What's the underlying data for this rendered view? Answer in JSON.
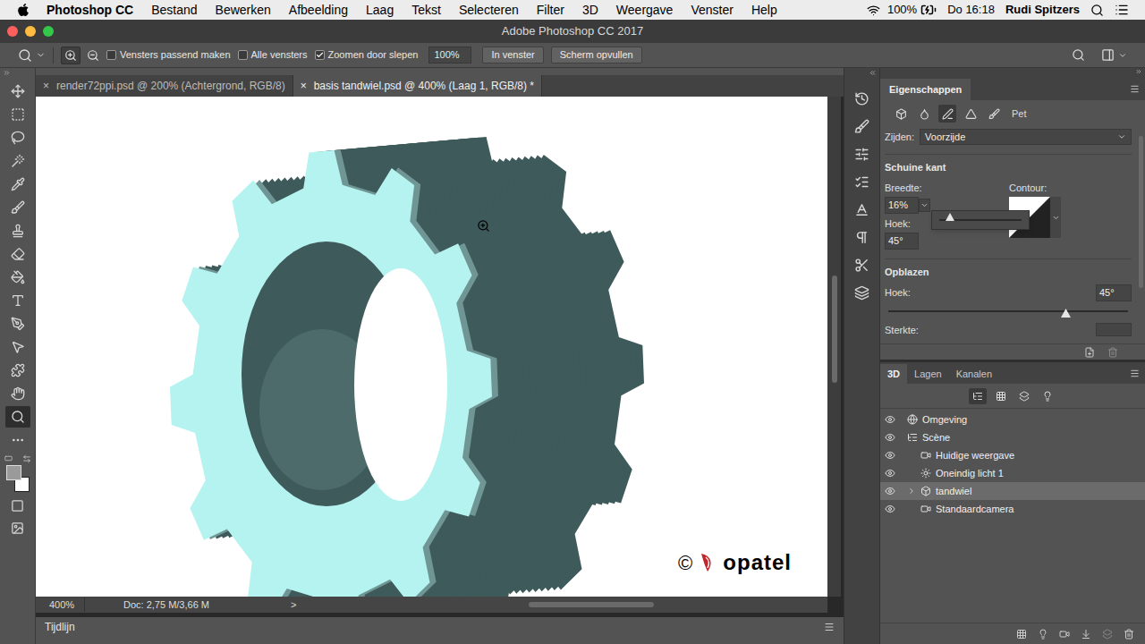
{
  "menubar": {
    "app": "Photoshop CC",
    "menus": [
      "Bestand",
      "Bewerken",
      "Afbeelding",
      "Laag",
      "Tekst",
      "Selecteren",
      "Filter",
      "3D",
      "Weergave",
      "Venster",
      "Help"
    ],
    "battery": "100%",
    "clock": "Do 16:18",
    "user": "Rudi Spitzers"
  },
  "window": {
    "title": "Adobe Photoshop CC 2017"
  },
  "options": {
    "checkboxes": [
      {
        "label": "Vensters passend maken",
        "checked": false
      },
      {
        "label": "Alle vensters",
        "checked": false
      },
      {
        "label": "Zoomen door slepen",
        "checked": true
      }
    ],
    "zoom": "100%",
    "buttons": [
      "In venster",
      "Scherm opvullen"
    ]
  },
  "tools": [
    {
      "selected": false
    },
    {
      "selected": false
    },
    {
      "selected": false
    },
    {
      "selected": false
    },
    {
      "selected": false
    },
    {
      "selected": false
    },
    {
      "selected": false
    },
    {
      "selected": false
    },
    {
      "selected": false
    },
    {
      "selected": false
    },
    {
      "selected": false
    },
    {
      "selected": false
    },
    {
      "selected": false
    },
    {
      "selected": false
    },
    {
      "selected": true
    },
    {
      "selected": false
    }
  ],
  "colors": {
    "foreground": "#9a9a9a",
    "background": "#ffffff"
  },
  "documents": [
    {
      "label": "render72ppi.psd @ 200% (Achtergrond, RGB/8)",
      "close": "×",
      "selected": false
    },
    {
      "label": "basis tandwiel.psd @ 400% (Laag 1, RGB/8) *",
      "close": "×",
      "selected": true
    }
  ],
  "canvas": {
    "watermark": {
      "symbol": "©",
      "text": "opatel"
    }
  },
  "status_bar": {
    "zoom": "400%",
    "doc": "Doc: 2,75 M/3,66 M",
    "arrow": ">"
  },
  "timeline": {
    "title": "Tijdlijn"
  },
  "properties": {
    "title": "Eigenschappen",
    "icon_tabs": [
      {
        "selected": false
      },
      {
        "selected": false
      },
      {
        "selected": true
      },
      {
        "selected": false
      },
      {
        "selected": false
      }
    ],
    "extra_label": "Pet",
    "sides_label": "Zijden:",
    "sides_value": "Voorzijde",
    "bevel": {
      "title": "Schuine kant",
      "width_label": "Breedte:",
      "width_value": "16%",
      "contour_label": "Contour:",
      "angle_label": "Hoek:",
      "angle_value": "45°",
      "popup_level": 0.13
    },
    "inflate": {
      "title": "Opblazen",
      "angle_label": "Hoek:",
      "angle_value": "45°",
      "level": 0.74,
      "strength_label": "Sterkte:"
    }
  },
  "panel3d": {
    "tabs": [
      {
        "label": "3D",
        "selected": true
      },
      {
        "label": "Lagen",
        "selected": false
      },
      {
        "label": "Kanalen",
        "selected": false
      }
    ],
    "filters": [
      {
        "selected": true
      },
      {
        "selected": false
      },
      {
        "selected": false
      },
      {
        "selected": false
      }
    ],
    "items": [
      {
        "label": "Omgeving",
        "kind": "environment",
        "depth": 0,
        "visible": true,
        "selected": false,
        "expandable": false
      },
      {
        "label": "Scène",
        "kind": "scene",
        "depth": 0,
        "visible": true,
        "selected": false,
        "expandable": false
      },
      {
        "label": "Huidige weergave",
        "kind": "camera",
        "depth": 1,
        "visible": true,
        "selected": false,
        "expandable": false
      },
      {
        "label": "Oneindig licht 1",
        "kind": "light",
        "depth": 1,
        "visible": true,
        "selected": false,
        "expandable": false
      },
      {
        "label": "tandwiel",
        "kind": "mesh",
        "depth": 1,
        "visible": true,
        "selected": true,
        "expandable": true
      },
      {
        "label": "Standaardcamera",
        "kind": "camera",
        "depth": 1,
        "visible": true,
        "selected": false,
        "expandable": false
      }
    ]
  }
}
